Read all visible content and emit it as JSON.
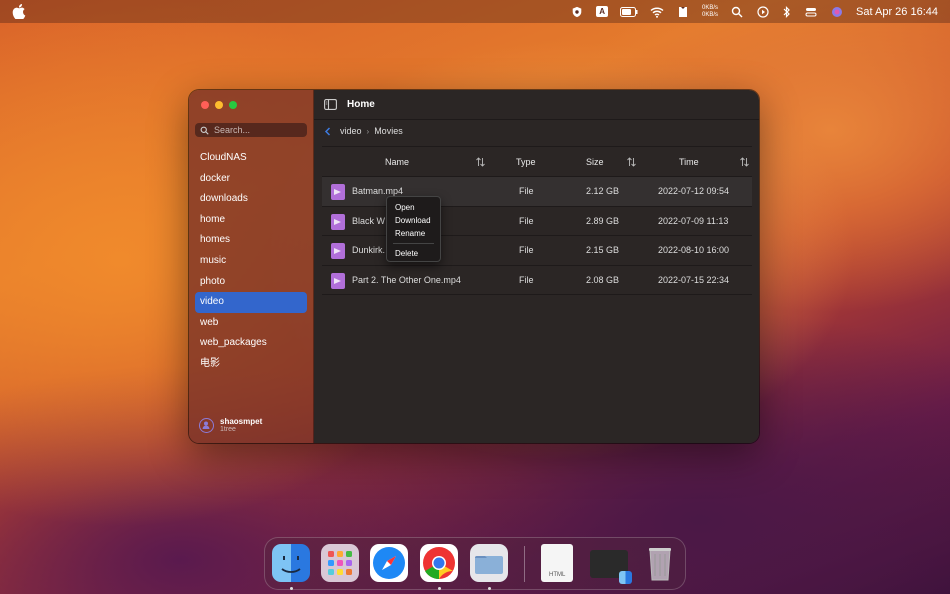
{
  "menubar": {
    "net_up": "0KB/s",
    "net_down": "0KB/s",
    "input_source": "A",
    "clock": "Sat Apr 26  16:44"
  },
  "window": {
    "title": "Home",
    "search_placeholder": "Search...",
    "sidebar": {
      "items": [
        "CloudNAS",
        "docker",
        "downloads",
        "home",
        "homes",
        "music",
        "photo",
        "video",
        "web",
        "web_packages",
        "电影"
      ],
      "active": "video"
    },
    "user": {
      "name": "shaosmpet",
      "sub": "1tree"
    },
    "breadcrumb": [
      "video",
      "Movies"
    ],
    "table": {
      "headers": {
        "name": "Name",
        "type": "Type",
        "size": "Size",
        "time": "Time"
      },
      "rows": [
        {
          "name": "Batman.mp4",
          "type": "File",
          "size": "2.12 GB",
          "time": "2022-07-12 09:54"
        },
        {
          "name": "Black W",
          "type": "File",
          "size": "2.89 GB",
          "time": "2022-07-09 11:13"
        },
        {
          "name": "Dunkirk.",
          "type": "File",
          "size": "2.15 GB",
          "time": "2022-08-10 16:00"
        },
        {
          "name": "Part 2. The Other One.mp4",
          "type": "File",
          "size": "2.08 GB",
          "time": "2022-07-15 22:34"
        }
      ]
    },
    "context_menu": [
      "Open",
      "Download",
      "Rename",
      "Delete"
    ]
  },
  "dock": {
    "apps": [
      "finder-icon",
      "launchpad-icon",
      "safari-icon",
      "chrome-icon",
      "files-icon",
      "html-document-icon",
      "preview-window-icon",
      "trash-icon"
    ],
    "html_label": "HTML"
  },
  "colors": {
    "accent": "#3366cc",
    "file_icon": "#b16fd9",
    "sidebar": "#78322a",
    "main": "#2b2625"
  }
}
